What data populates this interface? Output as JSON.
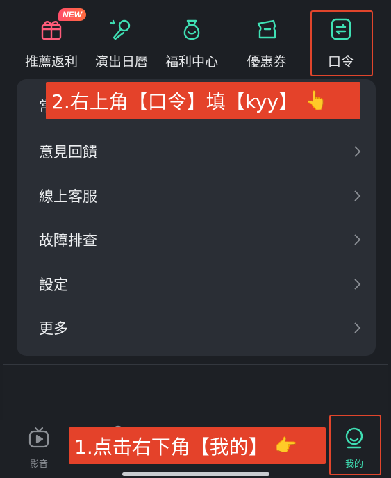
{
  "shortcuts": [
    {
      "label": "推薦返利",
      "icon": "gift-icon",
      "badge": "NEW"
    },
    {
      "label": "演出日曆",
      "icon": "microphone-icon"
    },
    {
      "label": "福利中心",
      "icon": "money-bag-icon"
    },
    {
      "label": "優惠券",
      "icon": "coupon-icon"
    },
    {
      "label": "口令",
      "icon": "code-swap-icon"
    }
  ],
  "menu": {
    "first_item_partial": "常",
    "items": [
      {
        "label": "意見回饋"
      },
      {
        "label": "線上客服"
      },
      {
        "label": "故障排查"
      },
      {
        "label": "設定"
      },
      {
        "label": "更多"
      }
    ]
  },
  "callouts": {
    "top": "2.右上角【口令】填【kyy】",
    "top_emoji": "👆",
    "bottom": "1.点击右下角【我的】",
    "bottom_emoji": "👉"
  },
  "tabbar": {
    "left_tab": {
      "label": "影音",
      "icon": "tv-play-icon"
    },
    "right_tab": {
      "label": "我的",
      "icon": "profile-icon"
    }
  },
  "colors": {
    "accent": "#3fe0b4",
    "highlight": "#e0452c",
    "callout_bg": "#e4422a",
    "background": "#1c1f24",
    "card": "#2a2e35"
  }
}
